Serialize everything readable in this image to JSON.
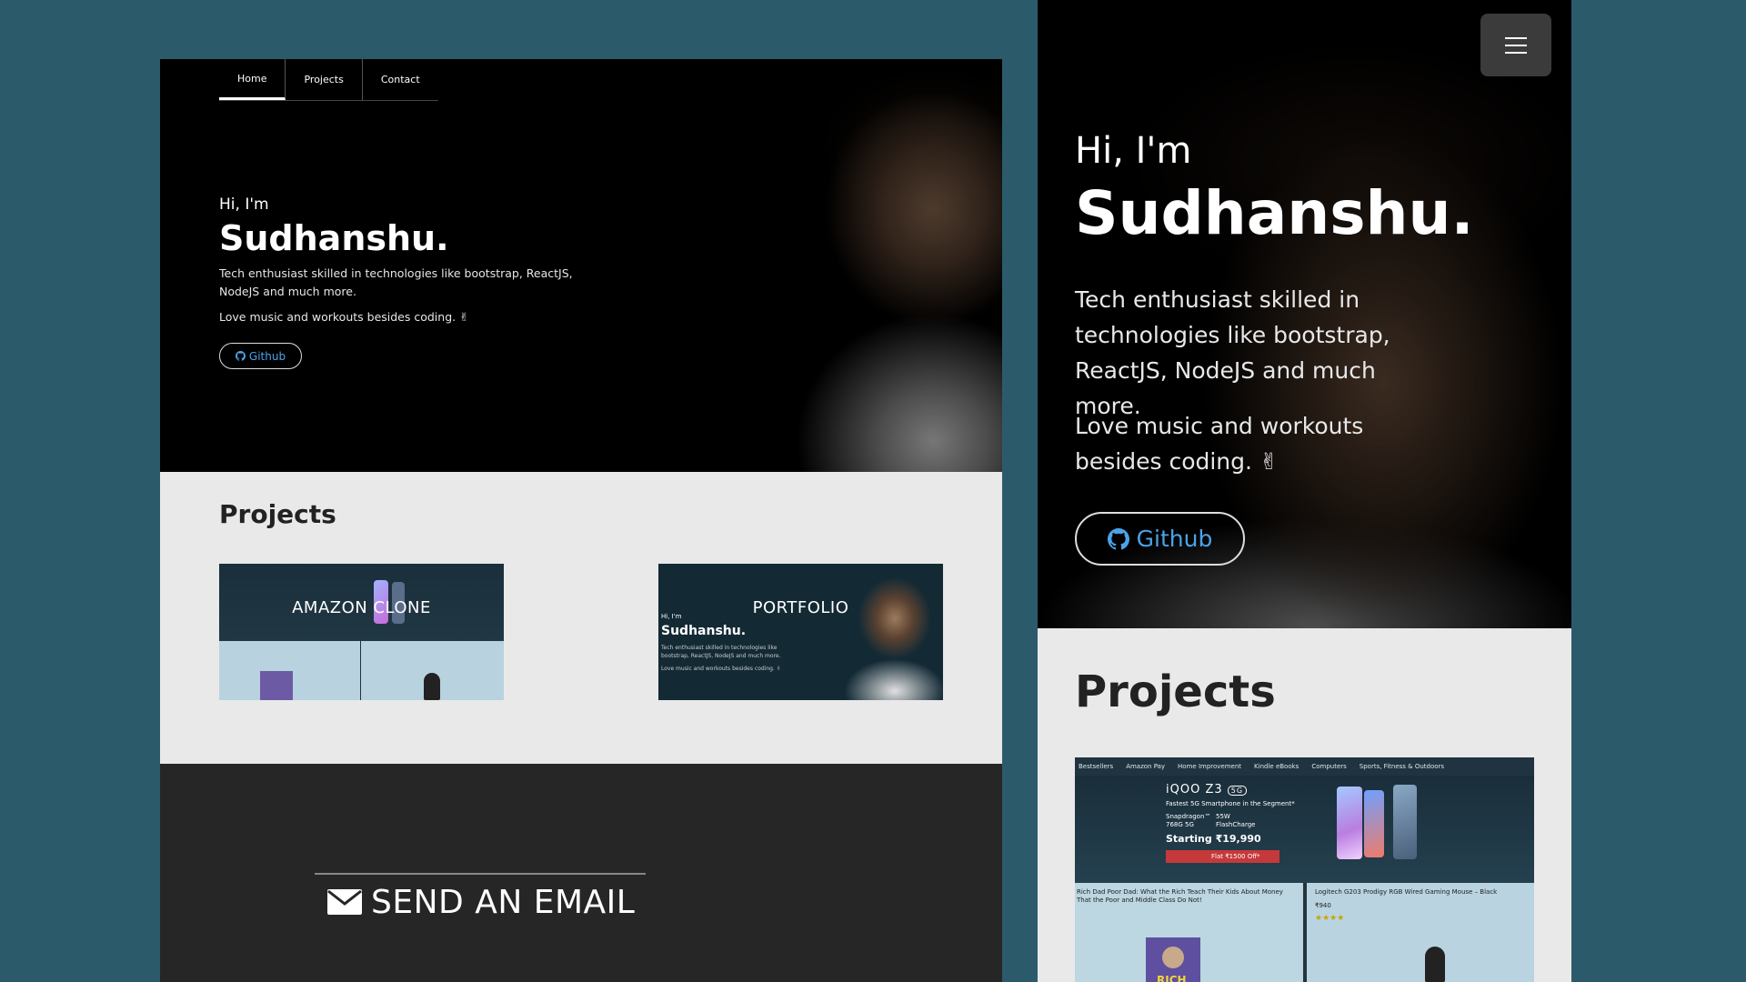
{
  "desktop": {
    "nav": {
      "tabs": [
        "Home",
        "Projects",
        "Contact"
      ],
      "active": "Home"
    },
    "hero": {
      "greeting": "Hi, I'm",
      "name": "Sudhanshu.",
      "description": "Tech enthusiast skilled in technologies like bootstrap, ReactJS, NodeJS and much more.",
      "hobbies": "Love music and workouts besides coding. ✌",
      "github_label": "Github"
    },
    "projects": {
      "title": "Projects",
      "items": [
        {
          "caption": "AMAZON CLONE"
        },
        {
          "caption": "PORTFOLIO"
        }
      ],
      "portfolio_thumb": {
        "greeting": "Hi, I'm",
        "name": "Sudhanshu.",
        "description": "Tech enthusiast skilled in technologies like bootstrap, ReactJS, NodeJS and much more.",
        "hobbies": "Love music and workouts besides coding. ✌"
      }
    },
    "footer": {
      "email_label": "SEND AN EMAIL"
    }
  },
  "mobile": {
    "hero": {
      "greeting": "Hi, I'm",
      "name": "Sudhanshu.",
      "description": "Tech enthusiast skilled in technologies like bootstrap, ReactJS, NodeJS and much more.",
      "hobbies": "Love music and workouts besides coding. ✌",
      "github_label": "Github"
    },
    "projects": {
      "title": "Projects",
      "amazon_thumb": {
        "nav": [
          "Bestsellers",
          "Amazon Pay",
          "Home Improvement",
          "Kindle eBooks",
          "Computers",
          "Sports, Fitness & Outdoors"
        ],
        "product": "iQOO Z3",
        "product_badge": "5G",
        "tagline": "Fastest 5G Smartphone in the Segment*",
        "spec1": "Snapdragon™ 768G 5G",
        "spec2": "55W FlashCharge",
        "price": "Starting ₹19,990",
        "offer": "Flat ₹1500 Off*",
        "book_title": "Rich Dad Poor Dad: What the Rich Teach Their Kids About Money That the Poor and Middle Class Do Not!",
        "mouse_title": "Logitech G203 Prodigy RGB Wired Gaming Mouse – Black",
        "mouse_price": "₹940",
        "stars": "★★★★",
        "book_cover_text": "RICH"
      }
    }
  },
  "colors": {
    "background": "#2b5b6b",
    "hero_bg": "#000000",
    "projects_bg": "#e9e9e9",
    "footer_bg": "#262626",
    "link_blue": "#4aa3e8"
  },
  "icons": {
    "github": "github-icon",
    "menu": "hamburger-menu-icon",
    "email": "envelope-icon"
  }
}
